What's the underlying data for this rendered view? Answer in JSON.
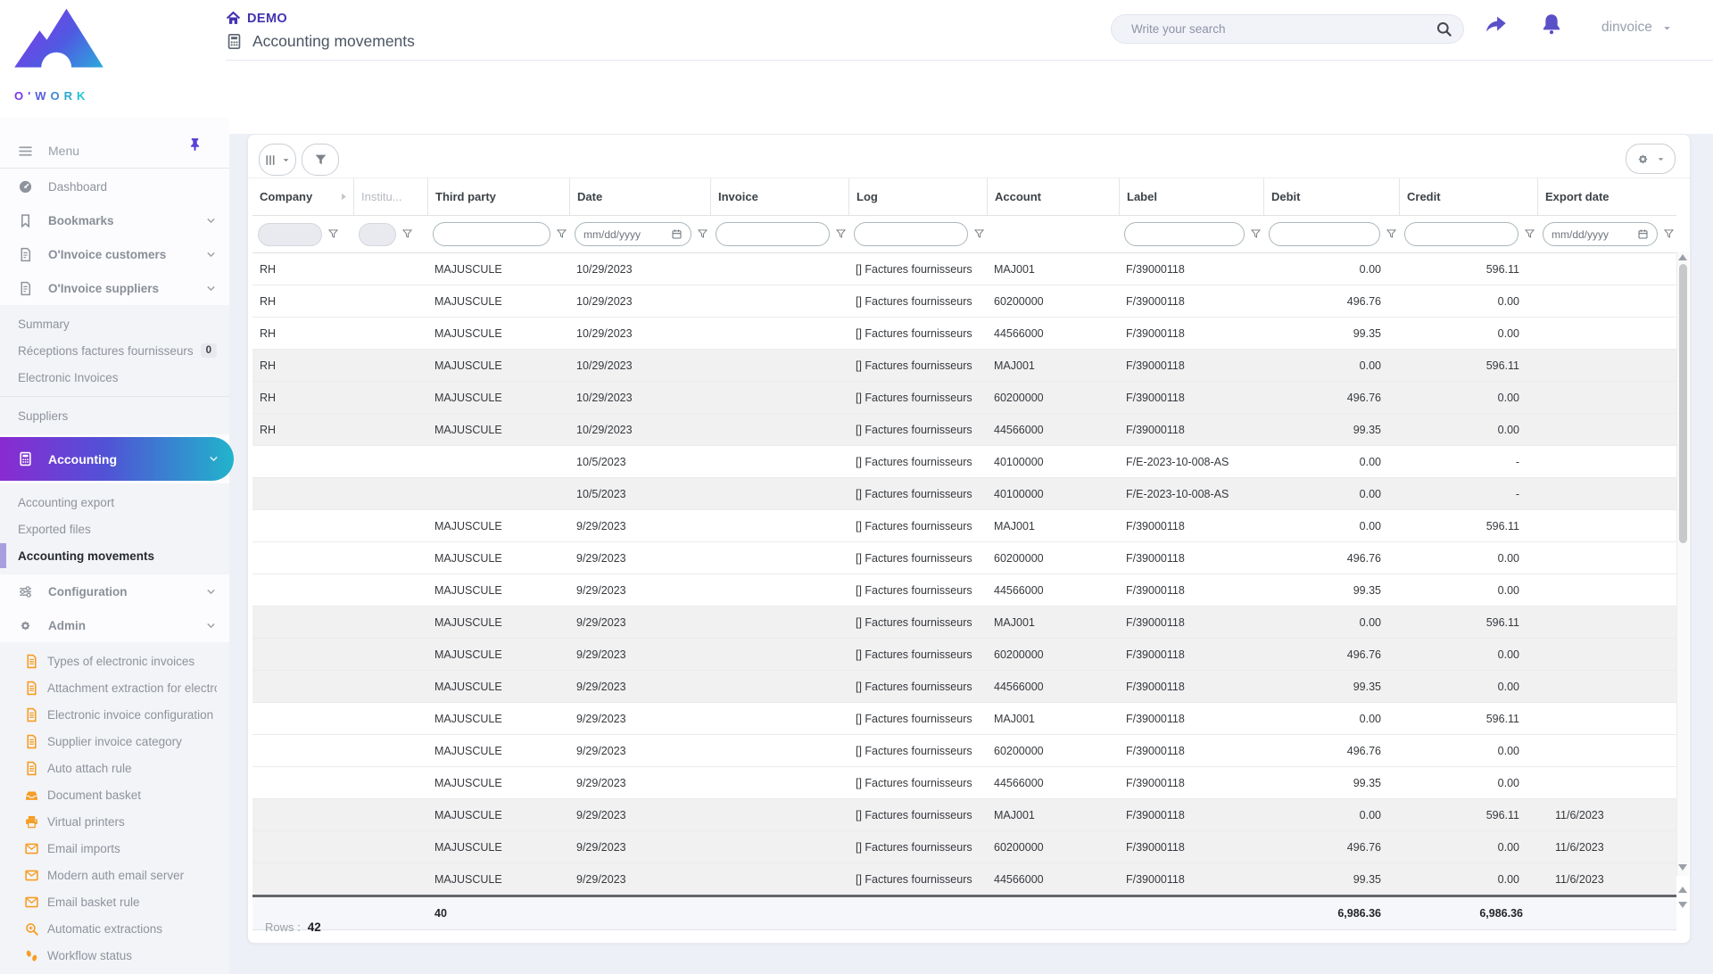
{
  "brand": {
    "name": "O'WORK"
  },
  "topbar": {
    "breadcrumb_root": "DEMO",
    "page_title": "Accounting movements",
    "search_placeholder": "Write your search",
    "user": "dinvoice"
  },
  "sidebar": {
    "menu_label": "Menu",
    "sections": [
      {
        "type": "item",
        "icon": "dashboard",
        "label": "Dashboard"
      },
      {
        "type": "item",
        "icon": "bookmark",
        "label": "Bookmarks",
        "bold": true,
        "chevron": true
      },
      {
        "type": "item",
        "icon": "invoice",
        "label": "O'Invoice customers",
        "bold": true,
        "chevron": true
      },
      {
        "type": "item",
        "icon": "invoice",
        "label": "O'Invoice suppliers",
        "bold": true,
        "chevron": true
      },
      {
        "type": "panel",
        "items": [
          {
            "label": "Summary"
          },
          {
            "label": "Réceptions factures fournisseurs",
            "badge": "0"
          },
          {
            "label": "Electronic Invoices",
            "divider_after": true
          },
          {
            "label": "Suppliers"
          }
        ]
      },
      {
        "type": "gradient",
        "icon": "calculator",
        "label": "Accounting",
        "chevron": true
      },
      {
        "type": "panel",
        "items": [
          {
            "label": "Accounting export"
          },
          {
            "label": "Exported files"
          },
          {
            "label": "Accounting movements",
            "active": true
          }
        ]
      },
      {
        "type": "item",
        "icon": "sliders",
        "label": "Configuration",
        "bold": true,
        "chevron": true
      },
      {
        "type": "item",
        "icon": "gear",
        "label": "Admin",
        "bold": true,
        "chevron": true
      },
      {
        "type": "panel",
        "items": [
          {
            "icon": "doc",
            "label": "Types of electronic invoices"
          },
          {
            "icon": "doc",
            "label": "Attachment extraction for electron"
          },
          {
            "icon": "doc",
            "label": "Electronic invoice configuration"
          },
          {
            "icon": "doc",
            "label": "Supplier invoice category"
          },
          {
            "icon": "doc",
            "label": "Auto attach rule"
          },
          {
            "icon": "basket",
            "label": "Document basket"
          },
          {
            "icon": "printer",
            "label": "Virtual printers"
          },
          {
            "icon": "envelope",
            "label": "Email imports"
          },
          {
            "icon": "envelope",
            "label": "Modern auth email server"
          },
          {
            "icon": "envelope",
            "label": "Email basket rule"
          },
          {
            "icon": "magnifier-plus",
            "label": "Automatic extractions"
          },
          {
            "icon": "footprints",
            "label": "Workflow status"
          }
        ]
      }
    ]
  },
  "table": {
    "date_placeholder": "mm/dd/yyyy",
    "columns": [
      {
        "label": "Company",
        "filter": "disabled"
      },
      {
        "label": "Institu...",
        "filter": "disabled",
        "dim": true,
        "small": true
      },
      {
        "label": "Third party",
        "filter": "text"
      },
      {
        "label": "Date",
        "filter": "date"
      },
      {
        "label": "Invoice",
        "filter": "text"
      },
      {
        "label": "Log",
        "filter": "text"
      },
      {
        "label": "Account",
        "filter": "none"
      },
      {
        "label": "Label",
        "filter": "text"
      },
      {
        "label": "Debit",
        "filter": "text"
      },
      {
        "label": "Credit",
        "filter": "text"
      },
      {
        "label": "Export date",
        "filter": "date"
      }
    ],
    "rows": [
      {
        "cells": [
          "RH",
          "",
          "MAJUSCULE",
          "10/29/2023",
          "",
          "[] Factures fournisseurs",
          "MAJ001",
          "F/39000118",
          "0.00",
          "596.11",
          ""
        ],
        "shaded": false
      },
      {
        "cells": [
          "RH",
          "",
          "MAJUSCULE",
          "10/29/2023",
          "",
          "[] Factures fournisseurs",
          "60200000",
          "F/39000118",
          "496.76",
          "0.00",
          ""
        ],
        "shaded": false
      },
      {
        "cells": [
          "RH",
          "",
          "MAJUSCULE",
          "10/29/2023",
          "",
          "[] Factures fournisseurs",
          "44566000",
          "F/39000118",
          "99.35",
          "0.00",
          ""
        ],
        "shaded": false
      },
      {
        "cells": [
          "RH",
          "",
          "MAJUSCULE",
          "10/29/2023",
          "",
          "[] Factures fournisseurs",
          "MAJ001",
          "F/39000118",
          "0.00",
          "596.11",
          ""
        ],
        "shaded": true
      },
      {
        "cells": [
          "RH",
          "",
          "MAJUSCULE",
          "10/29/2023",
          "",
          "[] Factures fournisseurs",
          "60200000",
          "F/39000118",
          "496.76",
          "0.00",
          ""
        ],
        "shaded": true
      },
      {
        "cells": [
          "RH",
          "",
          "MAJUSCULE",
          "10/29/2023",
          "",
          "[] Factures fournisseurs",
          "44566000",
          "F/39000118",
          "99.35",
          "0.00",
          ""
        ],
        "shaded": true
      },
      {
        "cells": [
          "",
          "",
          "",
          "10/5/2023",
          "",
          "[] Factures fournisseurs",
          "40100000",
          "F/E-2023-10-008-AS",
          "0.00",
          "-",
          ""
        ],
        "shaded": false
      },
      {
        "cells": [
          "",
          "",
          "",
          "10/5/2023",
          "",
          "[] Factures fournisseurs",
          "40100000",
          "F/E-2023-10-008-AS",
          "0.00",
          "-",
          ""
        ],
        "shaded": true
      },
      {
        "cells": [
          "",
          "",
          "MAJUSCULE",
          "9/29/2023",
          "",
          "[] Factures fournisseurs",
          "MAJ001",
          "F/39000118",
          "0.00",
          "596.11",
          ""
        ],
        "shaded": false
      },
      {
        "cells": [
          "",
          "",
          "MAJUSCULE",
          "9/29/2023",
          "",
          "[] Factures fournisseurs",
          "60200000",
          "F/39000118",
          "496.76",
          "0.00",
          ""
        ],
        "shaded": false
      },
      {
        "cells": [
          "",
          "",
          "MAJUSCULE",
          "9/29/2023",
          "",
          "[] Factures fournisseurs",
          "44566000",
          "F/39000118",
          "99.35",
          "0.00",
          ""
        ],
        "shaded": false
      },
      {
        "cells": [
          "",
          "",
          "MAJUSCULE",
          "9/29/2023",
          "",
          "[] Factures fournisseurs",
          "MAJ001",
          "F/39000118",
          "0.00",
          "596.11",
          ""
        ],
        "shaded": true
      },
      {
        "cells": [
          "",
          "",
          "MAJUSCULE",
          "9/29/2023",
          "",
          "[] Factures fournisseurs",
          "60200000",
          "F/39000118",
          "496.76",
          "0.00",
          ""
        ],
        "shaded": true
      },
      {
        "cells": [
          "",
          "",
          "MAJUSCULE",
          "9/29/2023",
          "",
          "[] Factures fournisseurs",
          "44566000",
          "F/39000118",
          "99.35",
          "0.00",
          ""
        ],
        "shaded": true
      },
      {
        "cells": [
          "",
          "",
          "MAJUSCULE",
          "9/29/2023",
          "",
          "[] Factures fournisseurs",
          "MAJ001",
          "F/39000118",
          "0.00",
          "596.11",
          ""
        ],
        "shaded": false
      },
      {
        "cells": [
          "",
          "",
          "MAJUSCULE",
          "9/29/2023",
          "",
          "[] Factures fournisseurs",
          "60200000",
          "F/39000118",
          "496.76",
          "0.00",
          ""
        ],
        "shaded": false
      },
      {
        "cells": [
          "",
          "",
          "MAJUSCULE",
          "9/29/2023",
          "",
          "[] Factures fournisseurs",
          "44566000",
          "F/39000118",
          "99.35",
          "0.00",
          ""
        ],
        "shaded": false
      },
      {
        "cells": [
          "",
          "",
          "MAJUSCULE",
          "9/29/2023",
          "",
          "[] Factures fournisseurs",
          "MAJ001",
          "F/39000118",
          "0.00",
          "596.11",
          "11/6/2023"
        ],
        "shaded": true
      },
      {
        "cells": [
          "",
          "",
          "MAJUSCULE",
          "9/29/2023",
          "",
          "[] Factures fournisseurs",
          "60200000",
          "F/39000118",
          "496.76",
          "0.00",
          "11/6/2023"
        ],
        "shaded": true
      },
      {
        "cells": [
          "",
          "",
          "MAJUSCULE",
          "9/29/2023",
          "",
          "[] Factures fournisseurs",
          "44566000",
          "F/39000118",
          "99.35",
          "0.00",
          "11/6/2023"
        ],
        "shaded": true
      }
    ],
    "totals": {
      "third_party_count": "40",
      "debit": "6,986.36",
      "credit": "6,986.36"
    },
    "footer": {
      "rows_label": "Rows :",
      "rows_count": "42"
    }
  }
}
